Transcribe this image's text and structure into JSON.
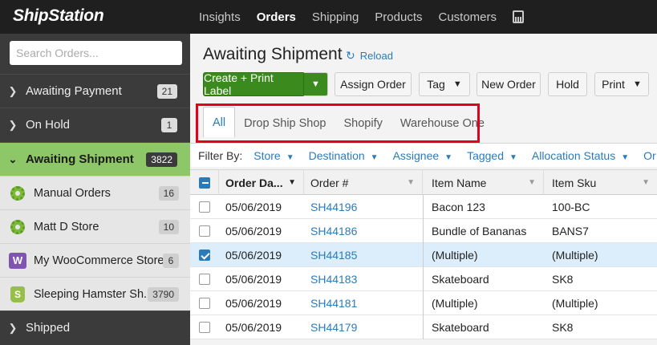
{
  "app": {
    "brand": "ShipStation"
  },
  "nav": {
    "items": [
      "Insights",
      "Orders",
      "Shipping",
      "Products",
      "Customers"
    ],
    "active": "Orders"
  },
  "sidebar": {
    "search_placeholder": "Search Orders...",
    "items": [
      {
        "label": "Awaiting Payment",
        "count": "21"
      },
      {
        "label": "On Hold",
        "count": "1"
      },
      {
        "label": "Awaiting Shipment",
        "count": "3822"
      }
    ],
    "stores": [
      {
        "label": "Manual Orders",
        "count": "16",
        "icon": "gear-icon"
      },
      {
        "label": "Matt D Store",
        "count": "10",
        "icon": "gear-icon"
      },
      {
        "label": "My WooCommerce Store",
        "count": "6",
        "icon": "woocommerce-icon"
      },
      {
        "label": "Sleeping Hamster Sh...",
        "count": "3790",
        "icon": "shopify-icon"
      }
    ],
    "shipped": {
      "label": "Shipped"
    }
  },
  "main": {
    "title": "Awaiting Shipment",
    "reload_label": "Reload",
    "buttons": {
      "create_print": "Create + Print Label",
      "assign_order": "Assign Order",
      "tag": "Tag",
      "new_order": "New Order",
      "hold": "Hold",
      "print": "Print"
    },
    "tabs": [
      "All",
      "Drop Ship Shop",
      "Shopify",
      "Warehouse One"
    ],
    "active_tab": "All",
    "filter_label": "Filter By:",
    "filters": [
      "Store",
      "Destination",
      "Assignee",
      "Tagged",
      "Allocation Status",
      "Or"
    ],
    "columns": [
      "Order Da...",
      "Order #",
      "Item Name",
      "Item Sku"
    ],
    "rows": [
      {
        "date": "05/06/2019",
        "order": "SH44196",
        "item": "Bacon 123",
        "sku": "100-BC",
        "checked": false
      },
      {
        "date": "05/06/2019",
        "order": "SH44186",
        "item": "Bundle of Bananas",
        "sku": "BANS7",
        "checked": false
      },
      {
        "date": "05/06/2019",
        "order": "SH44185",
        "item": "(Multiple)",
        "sku": "(Multiple)",
        "checked": true
      },
      {
        "date": "05/06/2019",
        "order": "SH44183",
        "item": "Skateboard",
        "sku": "SK8",
        "checked": false
      },
      {
        "date": "05/06/2019",
        "order": "SH44181",
        "item": "(Multiple)",
        "sku": "(Multiple)",
        "checked": false
      },
      {
        "date": "05/06/2019",
        "order": "SH44179",
        "item": "Skateboard",
        "sku": "SK8",
        "checked": false
      }
    ]
  },
  "colors": {
    "accent": "#2b7bb9",
    "brand_green": "#3b8a1e",
    "sidebar_active": "#8dc767",
    "highlight": "#e3001b"
  }
}
